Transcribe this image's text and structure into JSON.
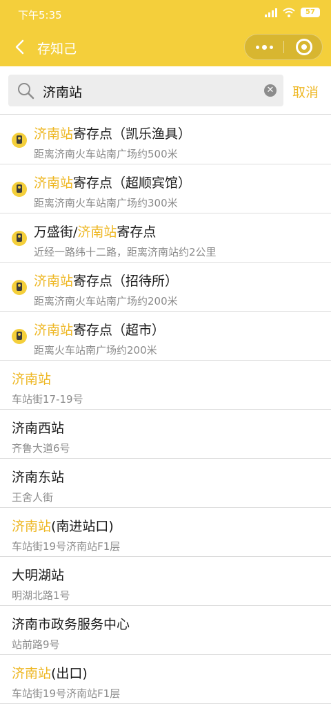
{
  "status_bar": {
    "time": "下午5:35",
    "battery": "57"
  },
  "nav": {
    "title": "存知己"
  },
  "search": {
    "query": "济南站",
    "cancel_label": "取消"
  },
  "results": [
    {
      "type": "shop",
      "pre": "",
      "hl": "济南站",
      "post": "寄存点（凯乐渔具）",
      "sub": "距离济南火车站南广场约500米"
    },
    {
      "type": "shop",
      "pre": "",
      "hl": "济南站",
      "post": "寄存点（超顺宾馆）",
      "sub": "距离济南火车站南广场约300米"
    },
    {
      "type": "shop",
      "pre": "万盛街/",
      "hl": "济南站",
      "post": "寄存点",
      "sub": "近经一路纬十二路，距离济南站约2公里"
    },
    {
      "type": "shop",
      "pre": "",
      "hl": "济南站",
      "post": "寄存点（招待所）",
      "sub": "距离济南火车站南广场约200米"
    },
    {
      "type": "shop",
      "pre": "",
      "hl": "济南站",
      "post": "寄存点（超市）",
      "sub": "距离火车站南广场约200米"
    },
    {
      "type": "place",
      "pre": "",
      "hl": "济南站",
      "post": "",
      "sub": "车站街17-19号"
    },
    {
      "type": "place",
      "pre": "济南西站",
      "hl": "",
      "post": "",
      "sub": "齐鲁大道6号"
    },
    {
      "type": "place",
      "pre": "济南东站",
      "hl": "",
      "post": "",
      "sub": "王舍人街"
    },
    {
      "type": "place",
      "pre": "",
      "hl": "济南站",
      "post": "(南进站口)",
      "sub": "车站街19号济南站F1层"
    },
    {
      "type": "place",
      "pre": "大明湖站",
      "hl": "",
      "post": "",
      "sub": "明湖北路1号"
    },
    {
      "type": "place",
      "pre": "济南市政务服务中心",
      "hl": "",
      "post": "",
      "sub": "站前路9号"
    },
    {
      "type": "place",
      "pre": "",
      "hl": "济南站",
      "post": "(出口)",
      "sub": "车站街19号济南站F1层"
    }
  ],
  "icons": {
    "back": "chevron-left-icon",
    "more": "more-dots-icon",
    "close": "target-close-icon",
    "search": "search-icon",
    "clear": "clear-icon",
    "pin": "location-pin-icon"
  },
  "colors": {
    "brand": "#f4cf3b",
    "highlight": "#eeb723",
    "subtext": "#8a8a8a"
  }
}
